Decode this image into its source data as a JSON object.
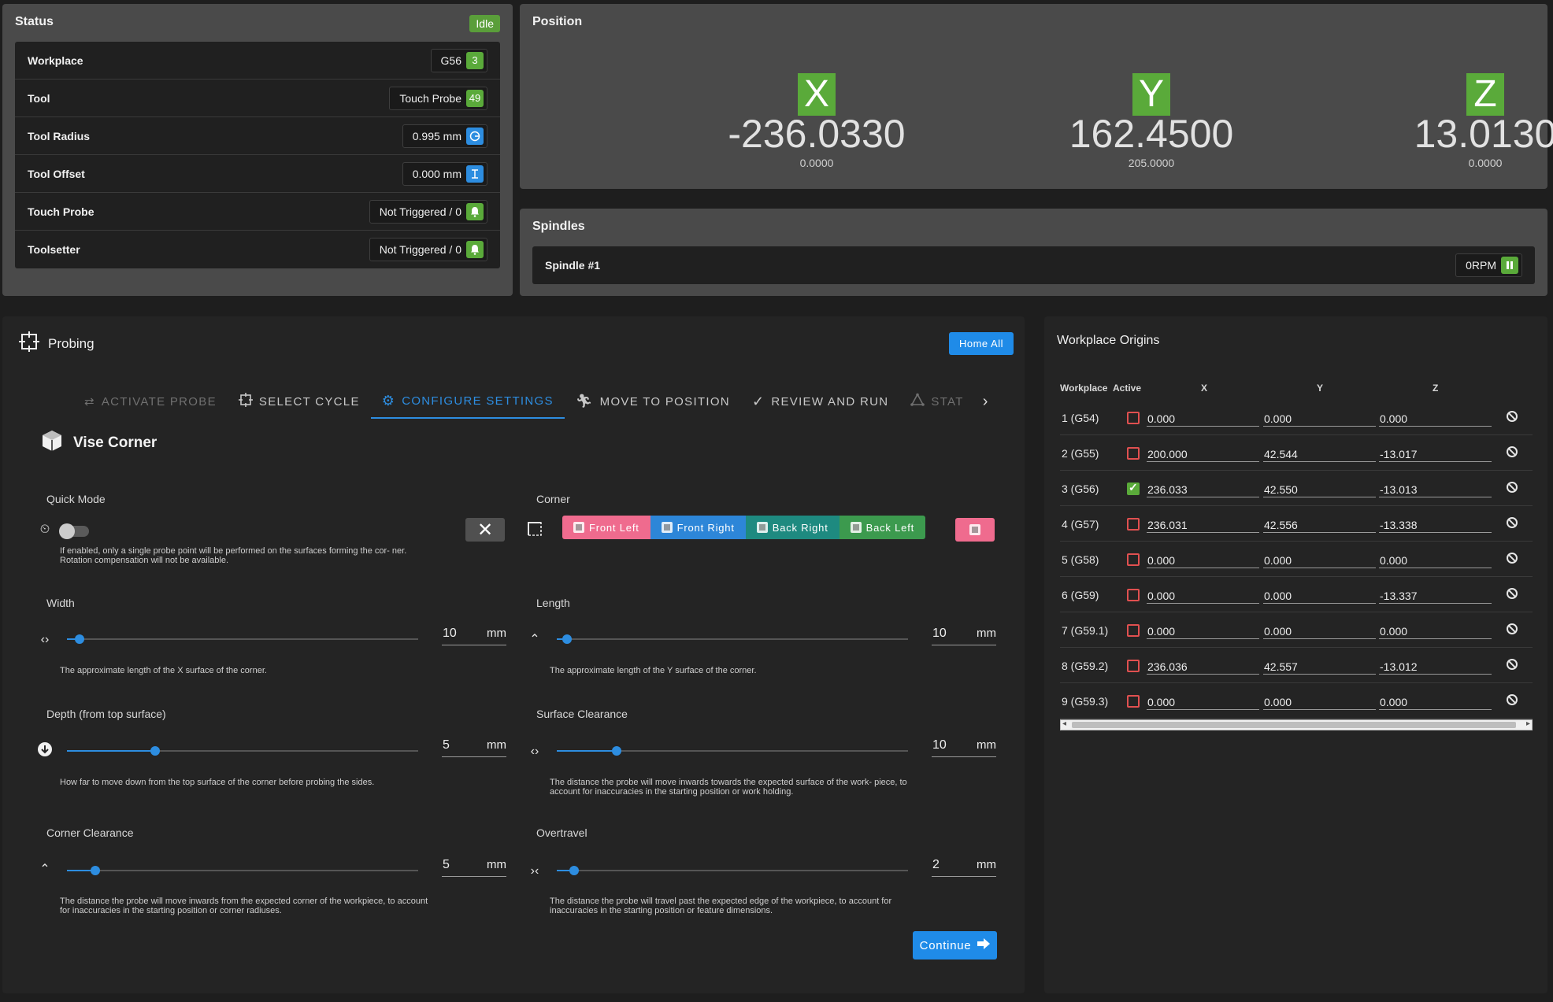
{
  "status": {
    "title": "Status",
    "state": "Idle",
    "rows": [
      {
        "label": "Workplace",
        "value": "G56",
        "chip": "3",
        "chip_color": "green"
      },
      {
        "label": "Tool",
        "value": "Touch Probe",
        "chip": "49",
        "chip_color": "green"
      },
      {
        "label": "Tool Radius",
        "value": "0.995 mm",
        "chip_icon": "radius-icon",
        "chip_color": "blue"
      },
      {
        "label": "Tool Offset",
        "value": "0.000 mm",
        "chip_icon": "offset-icon",
        "chip_color": "blue"
      },
      {
        "label": "Touch Probe",
        "value": "Not Triggered / 0",
        "chip_icon": "bell-icon",
        "chip_color": "green"
      },
      {
        "label": "Toolsetter",
        "value": "Not Triggered / 0",
        "chip_icon": "bell-icon",
        "chip_color": "green"
      }
    ]
  },
  "position": {
    "title": "Position",
    "axes": [
      {
        "letter": "X",
        "value": "-236.0330",
        "sub": "0.0000"
      },
      {
        "letter": "Y",
        "value": "162.4500",
        "sub": "205.0000"
      },
      {
        "letter": "Z",
        "value": "13.0130",
        "sub": "0.0000"
      }
    ]
  },
  "spindles": {
    "title": "Spindles",
    "name": "Spindle #1",
    "rpm": "0RPM"
  },
  "probing": {
    "title": "Probing",
    "home_all": "Home All",
    "steps": [
      {
        "label": "Activate Probe",
        "icon": "swap-icon"
      },
      {
        "label": "Select Cycle",
        "icon": "crosshair-icon"
      },
      {
        "label": "Configure Settings",
        "icon": "gear-icon"
      },
      {
        "label": "Move to Position",
        "icon": "run-icon"
      },
      {
        "label": "Review and Run",
        "icon": "check-icon"
      },
      {
        "label": "Stat",
        "icon": "triangle-icon"
      }
    ],
    "cycle": "Vise Corner",
    "quick_mode": {
      "label": "Quick Mode",
      "enabled": false,
      "help": "If enabled, only a single probe point will be performed on the surfaces forming the cor- ner. Rotation compensation will not be available."
    },
    "corner": {
      "label": "Corner",
      "options": [
        "Front Left",
        "Front Right",
        "Back Right",
        "Back Left"
      ],
      "selected": "Front Left"
    },
    "width": {
      "label": "Width",
      "value": "10",
      "unit": "mm",
      "fraction": 0.035,
      "help": "The approximate length of the X surface of the corner."
    },
    "length": {
      "label": "Length",
      "value": "10",
      "unit": "mm",
      "fraction": 0.03,
      "help": "The approximate length of the Y surface of the corner."
    },
    "depth": {
      "label": "Depth (from top surface)",
      "value": "5",
      "unit": "mm",
      "fraction": 0.25,
      "help": "How far to move down from the top surface of the corner before probing the sides."
    },
    "surface_clearance": {
      "label": "Surface Clearance",
      "value": "10",
      "unit": "mm",
      "fraction": 0.17,
      "help": "The distance the probe will move inwards towards the expected surface of the work- piece, to account for inaccuracies in the starting position or work holding."
    },
    "corner_clearance": {
      "label": "Corner Clearance",
      "value": "5",
      "unit": "mm",
      "fraction": 0.08,
      "help": "The distance the probe will move inwards from the expected corner of the workpiece, to account for inaccuracies in the starting position or corner radiuses."
    },
    "overtravel": {
      "label": "Overtravel",
      "value": "2",
      "unit": "mm",
      "fraction": 0.05,
      "help": "The distance the probe will travel past the expected edge of the workpiece, to account for inaccuracies in the starting position or feature dimensions."
    },
    "continue": "Continue"
  },
  "origins": {
    "title": "Workplace Origins",
    "headers": {
      "workplace": "Workplace",
      "active": "Active",
      "x": "X",
      "y": "Y",
      "z": "Z"
    },
    "rows": [
      {
        "name": "1 (G54)",
        "active": false,
        "x": "0.000",
        "y": "0.000",
        "z": "0.000"
      },
      {
        "name": "2 (G55)",
        "active": false,
        "x": "200.000",
        "y": "42.544",
        "z": "-13.017"
      },
      {
        "name": "3 (G56)",
        "active": true,
        "x": "236.033",
        "y": "42.550",
        "z": "-13.013"
      },
      {
        "name": "4 (G57)",
        "active": false,
        "x": "236.031",
        "y": "42.556",
        "z": "-13.338"
      },
      {
        "name": "5 (G58)",
        "active": false,
        "x": "0.000",
        "y": "0.000",
        "z": "0.000"
      },
      {
        "name": "6 (G59)",
        "active": false,
        "x": "0.000",
        "y": "0.000",
        "z": "-13.337"
      },
      {
        "name": "7 (G59.1)",
        "active": false,
        "x": "0.000",
        "y": "0.000",
        "z": "0.000"
      },
      {
        "name": "8 (G59.2)",
        "active": false,
        "x": "236.036",
        "y": "42.557",
        "z": "-13.012"
      },
      {
        "name": "9 (G59.3)",
        "active": false,
        "x": "0.000",
        "y": "0.000",
        "z": "0.000"
      }
    ]
  },
  "colors": {
    "accent": "#2d8de0",
    "success": "#5aaa3a",
    "corner_front_left": "#ef6b8e"
  }
}
